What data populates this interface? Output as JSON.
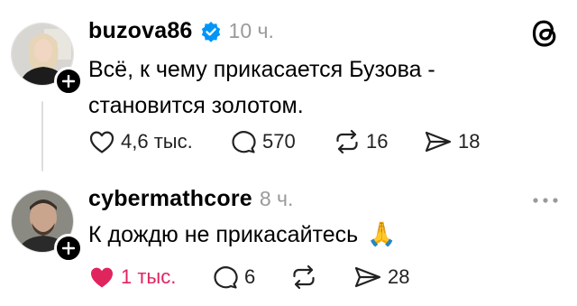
{
  "post": {
    "username": "buzova86",
    "verified": true,
    "time": "10 ч.",
    "text_line1": "Всё, к чему прикасается Бузова -",
    "text_line2": "становится золотом.",
    "likes": "4,6 тыс.",
    "replies": "570",
    "reposts": "16",
    "shares": "18"
  },
  "reply": {
    "username": "cybermathcore",
    "time": "8 ч.",
    "text": "К дождю не прикасайтесь",
    "emoji": "🙏",
    "likes": "1 тыс.",
    "liked": true,
    "replies": "6",
    "shares": "28"
  },
  "colors": {
    "like_red": "#e0245e",
    "verified_blue": "#0095f6",
    "muted": "#9a9a9a"
  },
  "icons": [
    "threads-logo-icon",
    "verified-badge-icon",
    "heart-icon",
    "comment-icon",
    "repost-icon",
    "share-icon",
    "more-icon",
    "plus-icon"
  ]
}
